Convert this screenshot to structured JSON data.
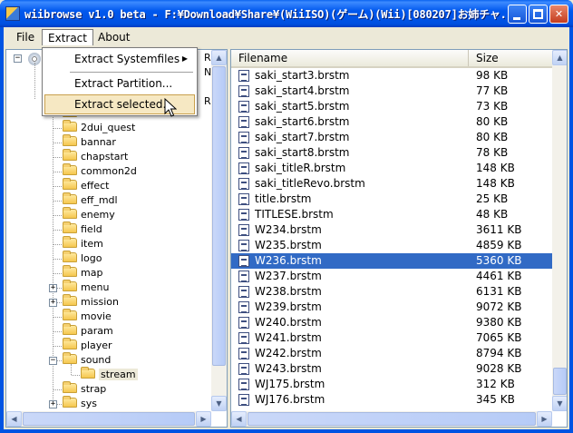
{
  "window": {
    "title": "wiibrowse v1.0 beta - F:¥Download¥Share¥(WiiISO)(ゲーム)(Wii)[080207]お姉チャ..."
  },
  "menubar": {
    "items": [
      "File",
      "Extract",
      "About"
    ]
  },
  "extract_menu": {
    "items": [
      {
        "label": "Extract Systemfiles",
        "submenu": true
      },
      {
        "label": "Extract Partition..."
      },
      {
        "label": "Extract selected..."
      }
    ]
  },
  "tree": {
    "root_suffix_1": "RO",
    "root_suffix_2": "N",
    "root_suffix_3": "R",
    "partial_node": "2dui",
    "nodes": [
      {
        "label": "2dui_quest",
        "expandable": false
      },
      {
        "label": "bannar",
        "expandable": false
      },
      {
        "label": "chapstart",
        "expandable": false
      },
      {
        "label": "common2d",
        "expandable": false
      },
      {
        "label": "effect",
        "expandable": false
      },
      {
        "label": "eff_mdl",
        "expandable": false
      },
      {
        "label": "enemy",
        "expandable": false
      },
      {
        "label": "field",
        "expandable": false
      },
      {
        "label": "item",
        "expandable": false
      },
      {
        "label": "logo",
        "expandable": false
      },
      {
        "label": "map",
        "expandable": false
      },
      {
        "label": "menu",
        "expandable": true
      },
      {
        "label": "mission",
        "expandable": true
      },
      {
        "label": "movie",
        "expandable": false
      },
      {
        "label": "param",
        "expandable": false
      },
      {
        "label": "player",
        "expandable": false
      },
      {
        "label": "sound",
        "expandable": "expanded"
      },
      {
        "label": "stream",
        "child": true,
        "selected": true
      },
      {
        "label": "strap",
        "expandable": false
      },
      {
        "label": "sys",
        "expandable": true
      }
    ]
  },
  "file_list": {
    "columns": [
      "Filename",
      "Size"
    ],
    "rows": [
      {
        "name": "saki_start3.brstm",
        "size": "98 KB"
      },
      {
        "name": "saki_start4.brstm",
        "size": "77 KB"
      },
      {
        "name": "saki_start5.brstm",
        "size": "73 KB"
      },
      {
        "name": "saki_start6.brstm",
        "size": "80 KB"
      },
      {
        "name": "saki_start7.brstm",
        "size": "80 KB"
      },
      {
        "name": "saki_start8.brstm",
        "size": "78 KB"
      },
      {
        "name": "saki_titleR.brstm",
        "size": "148 KB"
      },
      {
        "name": "saki_titleRevo.brstm",
        "size": "148 KB"
      },
      {
        "name": "title.brstm",
        "size": "25 KB"
      },
      {
        "name": "TITLESE.brstm",
        "size": "48 KB"
      },
      {
        "name": "W234.brstm",
        "size": "3611 KB"
      },
      {
        "name": "W235.brstm",
        "size": "4859 KB"
      },
      {
        "name": "W236.brstm",
        "size": "5360 KB",
        "selected": true
      },
      {
        "name": "W237.brstm",
        "size": "4461 KB"
      },
      {
        "name": "W238.brstm",
        "size": "6131 KB"
      },
      {
        "name": "W239.brstm",
        "size": "9072 KB"
      },
      {
        "name": "W240.brstm",
        "size": "9380 KB"
      },
      {
        "name": "W241.brstm",
        "size": "7065 KB"
      },
      {
        "name": "W242.brstm",
        "size": "8794 KB"
      },
      {
        "name": "W243.brstm",
        "size": "9028 KB"
      },
      {
        "name": "WJ175.brstm",
        "size": "312 KB"
      },
      {
        "name": "WJ176.brstm",
        "size": "345 KB"
      }
    ]
  },
  "colors": {
    "title_bar": "#0054E3",
    "selection": "#316AC5",
    "menu_hover": "#F6E8C3"
  }
}
